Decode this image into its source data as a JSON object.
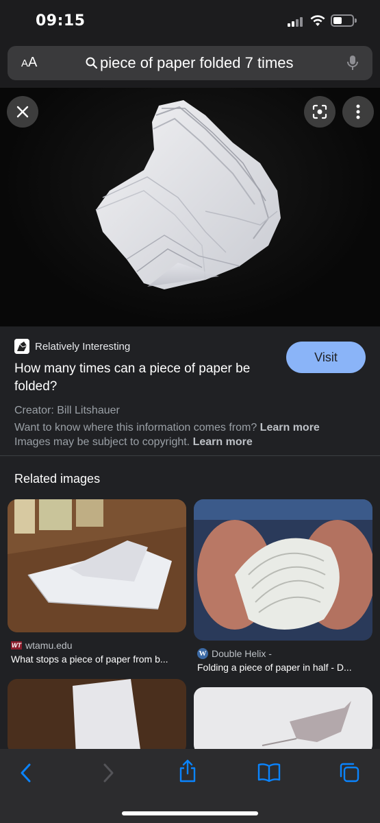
{
  "status": {
    "time": "09:15"
  },
  "urlbar": {
    "aa_small": "A",
    "aa_large": "A",
    "query": "piece of paper folded 7 times"
  },
  "result": {
    "source_name": "Relatively Interesting",
    "visit_label": "Visit",
    "headline": "How many times can a piece of paper be folded?",
    "creator": "Creator: Bill Litshauer",
    "want_text": "Want to know where this information comes from?",
    "copyright_text": "Images may be subject to copyright.",
    "learn_more": "Learn more"
  },
  "related": {
    "title": "Related images",
    "items": [
      {
        "source": "wtamu.edu",
        "logo_text": "WT",
        "title": "What stops a piece of paper from b..."
      },
      {
        "source": "Double Helix -",
        "logo_text": "W",
        "title": "Folding a piece of paper in half - D..."
      }
    ]
  },
  "icons": {
    "close": "close-icon",
    "lens": "lens-icon",
    "more": "more-vert-icon",
    "back": "chevron-left-icon",
    "forward": "chevron-right-icon",
    "share": "share-icon",
    "bookmarks": "book-icon",
    "tabs": "tabs-icon"
  },
  "colors": {
    "accent": "#8ab4f8",
    "toolbar_icon": "#0a84ff",
    "background": "#202124"
  }
}
